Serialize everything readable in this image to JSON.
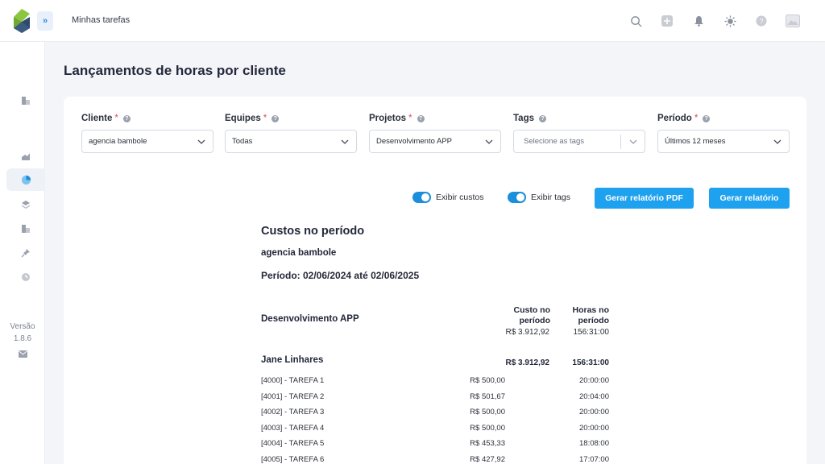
{
  "header": {
    "breadcrumb": "Minhas tarefas",
    "expand_glyph": "»",
    "icons": [
      "search-icon",
      "add-icon",
      "bell-icon",
      "theme-sun-icon",
      "help-icon",
      "user-avatar-icon"
    ]
  },
  "sidebar": {
    "items": [
      "report-icon",
      "chart-icon",
      "pie-chart-icon",
      "layers-icon",
      "report-icon",
      "pin-icon",
      "clock-icon"
    ],
    "version_label": "Versão",
    "version_number": "1.8.6",
    "mail_icon": "mail-icon"
  },
  "page": {
    "title": "Lançamentos de horas por cliente"
  },
  "filters": {
    "required_mark": "*",
    "info_glyph": "?",
    "cliente": {
      "label": "Cliente",
      "value": "agencia bambole"
    },
    "equipes": {
      "label": "Equipes",
      "value": "Todas"
    },
    "projetos": {
      "label": "Projetos",
      "value": "Desenvolvimento APP"
    },
    "tags": {
      "label": "Tags",
      "placeholder": "Selecione as tags"
    },
    "periodo": {
      "label": "Período",
      "value": "Últimos 12 meses"
    }
  },
  "controls": {
    "show_costs": "Exibir custos",
    "show_tags": "Exibir tags",
    "pdf_button": "Gerar relatório PDF",
    "report_button": "Gerar relatório"
  },
  "report": {
    "title": "Custos no período",
    "client": "agencia bambole",
    "period": "Período: 02/06/2024 até 02/06/2025",
    "project": "Desenvolvimento APP",
    "col_cost_header": [
      "Custo no",
      "período"
    ],
    "col_hours_header": [
      "Horas no",
      "período"
    ],
    "project_cost": "R$ 3.912,92",
    "project_hours": "156:31:00",
    "person": "Jane Linhares",
    "person_cost": "R$ 3.912,92",
    "person_hours": "156:31:00",
    "tasks": [
      {
        "name": "[4000] - TAREFA 1",
        "cost": "R$ 500,00",
        "hours": "20:00:00"
      },
      {
        "name": "[4001] - TAREFA 2",
        "cost": "R$ 501,67",
        "hours": "20:04:00"
      },
      {
        "name": "[4002] - TAREFA 3",
        "cost": "R$ 500,00",
        "hours": "20:00:00"
      },
      {
        "name": "[4003] - TAREFA 4",
        "cost": "R$ 500,00",
        "hours": "20:00:00"
      },
      {
        "name": "[4004] - TAREFA 5",
        "cost": "R$ 453,33",
        "hours": "18:08:00"
      },
      {
        "name": "[4005] - TAREFA 6",
        "cost": "R$ 427,92",
        "hours": "17:07:00"
      }
    ]
  },
  "colors": {
    "accent": "#1ea1ee",
    "required": "#e14b5a",
    "logo_green": "#8cc63f",
    "logo_navy": "#2f4a6d"
  }
}
